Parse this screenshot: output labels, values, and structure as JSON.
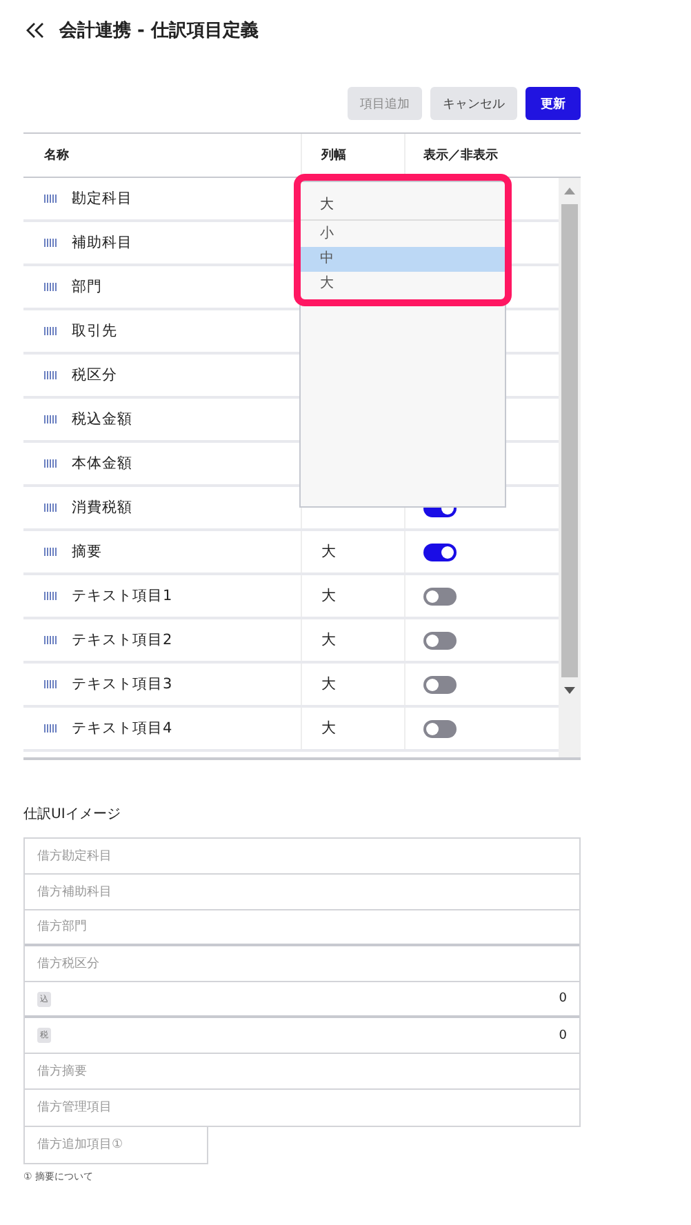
{
  "header": {
    "title": "会計連携 - 仕訳項目定義"
  },
  "buttons": [
    {
      "label": "項目追加",
      "kind": "secondary",
      "disabled": true
    },
    {
      "label": "キャンセル",
      "kind": "secondary",
      "disabled": false
    },
    {
      "label": "更新",
      "kind": "primary",
      "disabled": false
    }
  ],
  "table": {
    "columns": [
      "名称",
      "列幅",
      "表示／非表示"
    ],
    "rows": [
      {
        "name": "勘定科目"
      },
      {
        "name": "補助科目"
      },
      {
        "name": "部門"
      },
      {
        "name": "取引先"
      },
      {
        "name": "税区分"
      },
      {
        "name": "税込金額"
      },
      {
        "name": "本体金額"
      },
      {
        "name": "消費税額",
        "on": true
      },
      {
        "name": "摘要",
        "width": "大",
        "on": true
      },
      {
        "name": "テキスト項目1",
        "width": "大",
        "on": false
      },
      {
        "name": "テキスト項目2",
        "width": "大",
        "on": false
      },
      {
        "name": "テキスト項目3",
        "width": "大",
        "on": false
      },
      {
        "name": "テキスト項目4",
        "width": "大",
        "on": false
      }
    ]
  },
  "dropdown": {
    "value": "大",
    "highlighted": true,
    "options": [
      {
        "label": "小",
        "highlighted": false
      },
      {
        "label": "中",
        "highlighted": true
      },
      {
        "label": "大",
        "highlighted": false
      }
    ]
  },
  "preview": {
    "title": "仕訳UIイメージ",
    "rows": [
      {
        "kind": "field",
        "placeholder": "借方勘定科目",
        "group_end": false
      },
      {
        "kind": "field",
        "placeholder": "借方補助科目",
        "group_end": false
      },
      {
        "kind": "field",
        "placeholder": "借方部門",
        "group_end": true
      },
      {
        "kind": "field",
        "placeholder": "借方税区分",
        "group_end": false
      },
      {
        "kind": "amount",
        "badge": "込",
        "value": "0",
        "group_end": true
      },
      {
        "kind": "amount",
        "badge": "税",
        "value": "0",
        "group_end": false
      },
      {
        "kind": "field",
        "placeholder": "借方摘要",
        "group_end": false
      },
      {
        "kind": "field",
        "placeholder": "借方管理項目",
        "group_end": false
      }
    ],
    "extra_field": {
      "placeholder": "借方追加項目①"
    },
    "note": "① 摘要について"
  }
}
